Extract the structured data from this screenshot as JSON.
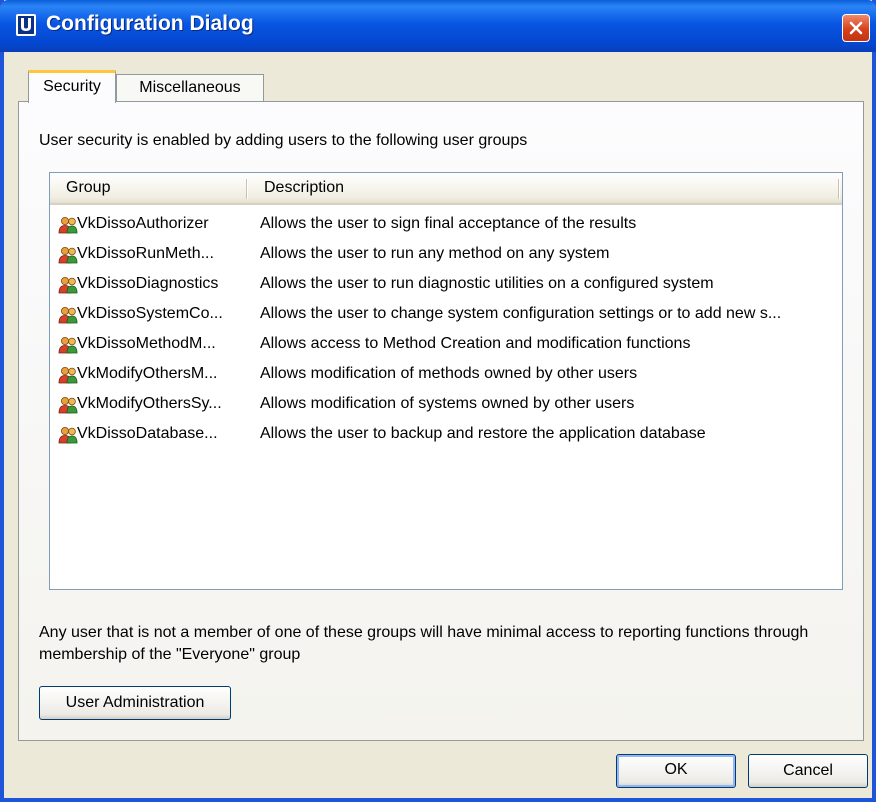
{
  "window": {
    "title": "Configuration Dialog"
  },
  "tabs": [
    {
      "label": "Security",
      "active": true
    },
    {
      "label": "Miscellaneous",
      "active": false
    }
  ],
  "security": {
    "intro": "User security is enabled by adding users to the following user groups",
    "columns": {
      "group": "Group",
      "description": "Description"
    },
    "groups": [
      {
        "name": "VkDissoAuthorizer",
        "description": "Allows the user to sign final acceptance of the results",
        "icon": "user-group-icon"
      },
      {
        "name": "VkDissoRunMeth...",
        "description": "Allows the user to run any method on any system",
        "icon": "user-group-icon"
      },
      {
        "name": "VkDissoDiagnostics",
        "description": "Allows the user to run diagnostic utilities on a configured system",
        "icon": "user-group-icon"
      },
      {
        "name": "VkDissoSystemCo...",
        "description": "Allows the user to change system configuration settings or to add new s...",
        "icon": "user-group-icon"
      },
      {
        "name": "VkDissoMethodM...",
        "description": "Allows access to Method Creation and modification functions",
        "icon": "user-group-icon"
      },
      {
        "name": "VkModifyOthersM...",
        "description": "Allows modification of methods owned by other users",
        "icon": "user-group-icon"
      },
      {
        "name": "VkModifyOthersSy...",
        "description": "Allows modification of systems owned by other users",
        "icon": "user-group-icon"
      },
      {
        "name": "VkDissoDatabase...",
        "description": "Allows the user to backup and restore the application database",
        "icon": "user-group-icon"
      }
    ],
    "footer_note": "Any user that is not a member of one of these groups will have minimal access to reporting functions through membership of the \"Everyone\" group",
    "user_admin_label": "User Administration"
  },
  "buttons": {
    "ok": "OK",
    "cancel": "Cancel"
  },
  "colors": {
    "titlebar": "#0446cf",
    "dialog_bg": "#ece9d8",
    "close": "#d6411d",
    "active_tab_accent": "#ffc83c"
  }
}
